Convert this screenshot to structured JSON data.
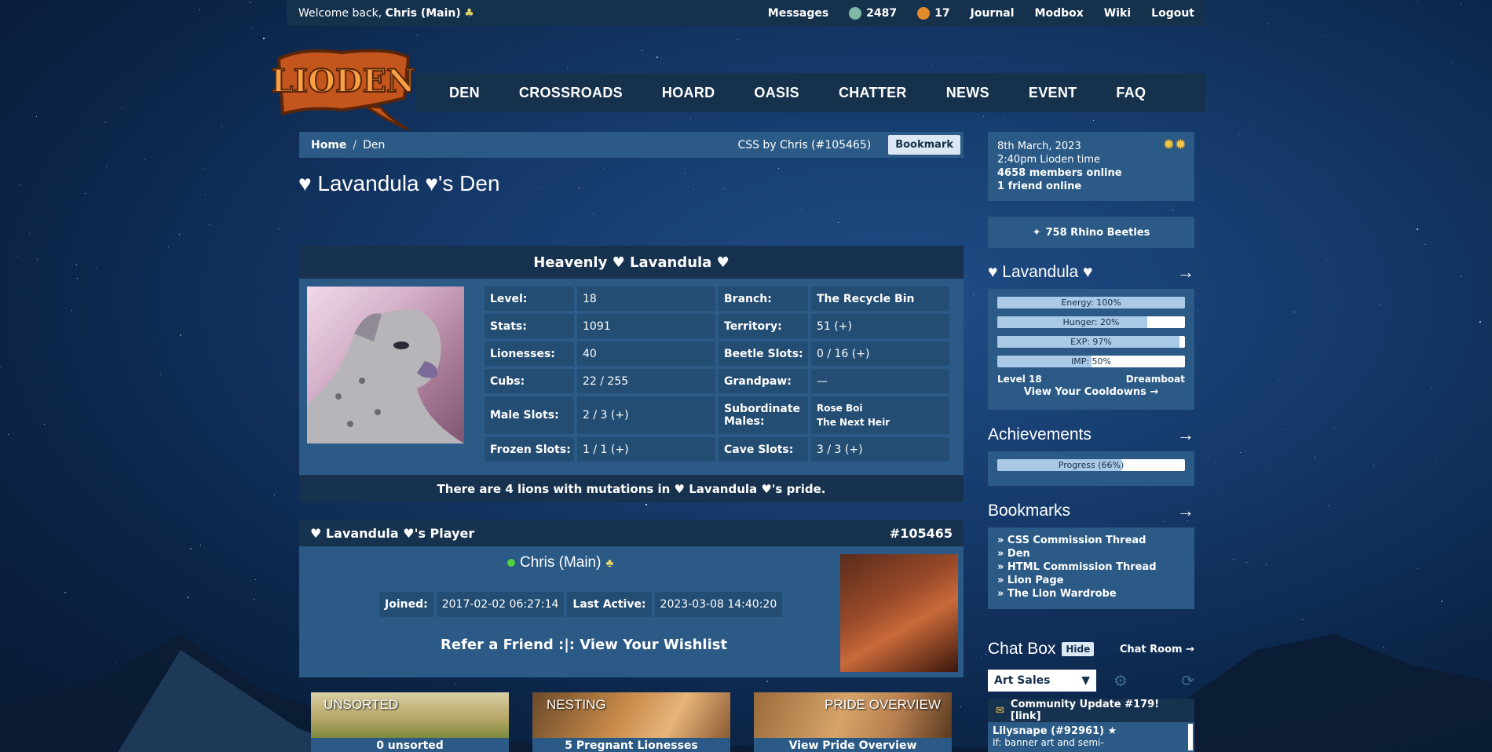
{
  "topbar": {
    "welcome_prefix": "Welcome back,",
    "user": "Chris (Main)",
    "messages": "Messages",
    "beetles_count": "2487",
    "gems_count": "17",
    "journal": "Journal",
    "modbox": "Modbox",
    "wiki": "Wiki",
    "logout": "Logout"
  },
  "logo_text": "LIODEN",
  "nav": [
    "DEN",
    "CROSSROADS",
    "HOARD",
    "OASIS",
    "CHATTER",
    "NEWS",
    "EVENT",
    "FAQ"
  ],
  "breadcrumb": {
    "home": "Home",
    "sep": "/",
    "current": "Den",
    "css_credit": "CSS by Chris (#105465)",
    "bookmark": "Bookmark"
  },
  "page_title": "♥ Lavandula ♥'s Den",
  "den": {
    "heading": "Heavenly ♥ Lavandula ♥",
    "rows": [
      {
        "l1": "Level:",
        "v1": "18",
        "l2": "Branch:",
        "v2": "The Recycle Bin"
      },
      {
        "l1": "Stats:",
        "v1": "1091",
        "l2": "Territory:",
        "v2": "51 (+)"
      },
      {
        "l1": "Lionesses:",
        "v1": "40",
        "l2": "Beetle Slots:",
        "v2": "0 / 16 (+)"
      },
      {
        "l1": "Cubs:",
        "v1": "22 / 255",
        "l2": "Grandpaw:",
        "v2": "—"
      },
      {
        "l1": "Male Slots:",
        "v1": "2 / 3 (+)",
        "l2": "Subordinate Males:",
        "v2a": "Rose Boi",
        "v2b": "The Next Heir"
      },
      {
        "l1": "Frozen Slots:",
        "v1": "1 / 1 (+)",
        "l2": "Cave Slots:",
        "v2": "3 / 3 (+)"
      }
    ],
    "footer": "There are 4 lions with mutations in ♥ Lavandula ♥'s pride."
  },
  "player": {
    "heading": "♥ Lavandula ♥'s Player",
    "id": "#105465",
    "name": "Chris (Main)",
    "joined_label": "Joined:",
    "joined": "2017-02-02 06:27:14",
    "active_label": "Last Active:",
    "active": "2023-03-08 14:40:20",
    "refer": "Refer a Friend :|: View Your Wishlist"
  },
  "tiles": [
    {
      "label": "UNSORTED",
      "caption": "0 unsorted"
    },
    {
      "label": "NESTING",
      "caption": "5 Pregnant Lionesses"
    },
    {
      "label": "PRIDE OVERVIEW",
      "caption": "View Pride Overview"
    }
  ],
  "sidebar": {
    "date": "8th March, 2023",
    "time": "2:40pm Lioden time",
    "members": "4658 members online",
    "friends": "1 friend online",
    "beetles": "758 Rhino Beetles",
    "lion_name": "♥ Lavandula ♥",
    "bars": [
      {
        "label": "Energy: 100%",
        "value": 1.0
      },
      {
        "label": "Hunger: 20%",
        "value": 0.8
      },
      {
        "label": "EXP: 97%",
        "value": 0.97
      },
      {
        "label": "IMP: 50%",
        "value": 0.5
      }
    ],
    "level": "Level 18",
    "title": "Dreamboat",
    "cooldowns": "View Your Cooldowns →",
    "achievements": "Achievements",
    "progress": {
      "label": "Progress (66%)",
      "value": 0.66
    },
    "bookmarks_head": "Bookmarks",
    "bookmarks": [
      "» CSS Commission Thread",
      "» Den",
      "» HTML Commission Thread",
      "» Lion Page",
      "» The Lion Wardrobe"
    ],
    "chat_head": "Chat Box",
    "hide": "Hide",
    "chat_room": "Chat Room →",
    "channel": "Art Sales",
    "community": "Community Update #179! [link]",
    "chat_user": "Lilysnape (#92961) ★",
    "chat_msg": "If: banner art and semi-",
    "arrow": "→"
  },
  "colors": {
    "panel": "#2a5a85",
    "dark": "#17324e",
    "accent": "#dbe7f3"
  }
}
